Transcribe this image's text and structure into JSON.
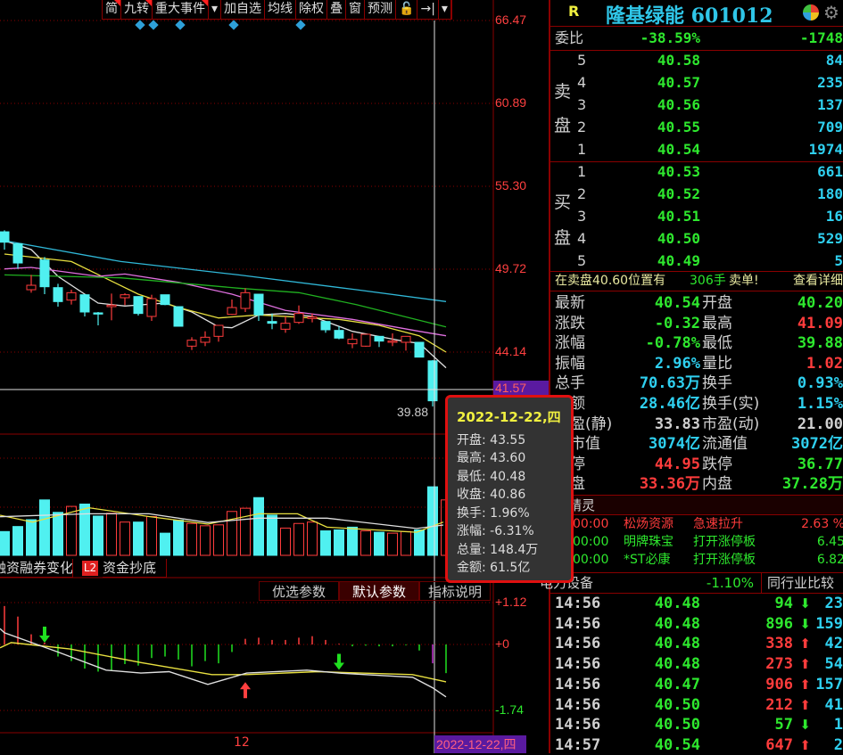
{
  "toolbar": {
    "items": [
      "简",
      "九转",
      "重大事件",
      "▾",
      "加自选",
      "均线",
      "除权",
      "叠",
      "窗",
      "预测",
      "🔓",
      "→|",
      "▾"
    ]
  },
  "colors": {
    "up": "#ff3c3c",
    "down": "#50f0f0",
    "ma5": "#e0e0e0",
    "ma10": "#e8e040",
    "ma20": "#e070e0",
    "ma30": "#20b020",
    "ma60": "#30b8d8",
    "grid": "#8a0000"
  },
  "price_axis": {
    "labels": [
      "66.47",
      "60.89",
      "55.30",
      "49.72",
      "44.14"
    ],
    "cursor_price": "41.57",
    "low_label": "39.88"
  },
  "indicator_axis": {
    "labels": [
      "+1.12",
      "+0",
      "-1.74"
    ]
  },
  "date_axis": {
    "tick": "12",
    "cursor_date": "2022-12-22,四"
  },
  "lower_tabs": {
    "tab1": "融资融券变化",
    "badge": "L2",
    "tab2": "资金抄底",
    "btn_pref": "优选参数",
    "btn_default": "默认参数",
    "btn_help": "指标说明"
  },
  "chart_data": {
    "type": "candlestick",
    "ylim": [
      39.88,
      66.47
    ],
    "candles": [
      [
        52.24,
        51.54,
        52.34,
        51.04
      ],
      [
        51.44,
        50.14,
        51.44,
        49.74
      ],
      [
        48.34,
        48.64,
        49.34,
        48.14
      ],
      [
        50.34,
        48.54,
        50.54,
        48.04
      ],
      [
        48.48,
        47.54,
        48.74,
        47.2
      ],
      [
        47.64,
        48.14,
        48.34,
        47.34
      ],
      [
        48.0,
        46.84,
        48.04,
        46.54
      ],
      [
        46.78,
        46.7,
        46.84,
        45.94
      ],
      [
        47.2,
        47.3,
        48.08,
        46.28
      ],
      [
        47.8,
        48.0,
        48.1,
        47.3
      ],
      [
        47.88,
        46.74,
        47.9,
        46.6
      ],
      [
        46.54,
        47.74,
        48.0,
        46.24
      ],
      [
        48.0,
        47.34,
        48.0,
        47.3
      ],
      [
        47.2,
        45.88,
        47.2,
        45.88
      ],
      [
        44.54,
        44.94,
        45.14,
        44.28
      ],
      [
        44.8,
        45.14,
        45.54,
        44.54
      ],
      [
        45.2,
        45.94,
        45.94,
        44.84
      ],
      [
        46.68,
        47.14,
        47.68,
        46.64
      ],
      [
        47.08,
        48.14,
        48.44,
        46.84
      ],
      [
        48.04,
        46.64,
        48.04,
        46.24
      ],
      [
        46.2,
        46.08,
        46.74,
        45.68
      ],
      [
        45.68,
        46.08,
        46.54,
        45.44
      ],
      [
        46.14,
        46.74,
        47.28,
        46.04
      ],
      [
        46.4,
        46.5,
        46.74,
        46.14
      ],
      [
        46.2,
        45.64,
        46.24,
        45.44
      ],
      [
        45.6,
        45.08,
        45.88,
        45.0
      ],
      [
        44.7,
        45.0,
        45.4,
        44.4
      ],
      [
        44.54,
        45.34,
        45.34,
        44.5
      ],
      [
        45.2,
        44.88,
        45.2,
        44.48
      ],
      [
        44.8,
        44.88,
        45.4,
        44.54
      ],
      [
        44.8,
        45.2,
        45.2,
        44.24
      ],
      [
        44.8,
        43.8,
        44.8,
        43.8
      ],
      [
        43.55,
        40.86,
        43.6,
        40.48
      ]
    ],
    "ma": [
      {
        "name": "MA5",
        "pts": [
          [
            0,
            51.64
          ],
          [
            2,
            51.04
          ],
          [
            4,
            49.24
          ],
          [
            7,
            47.44
          ],
          [
            9,
            47.24
          ],
          [
            12,
            47.44
          ],
          [
            14,
            46.84
          ],
          [
            16,
            45.84
          ],
          [
            17,
            45.78
          ],
          [
            19,
            46.64
          ],
          [
            21,
            46.74
          ],
          [
            23,
            46.54
          ],
          [
            26,
            45.54
          ],
          [
            30,
            44.84
          ],
          [
            31,
            44.74
          ],
          [
            33,
            43.08
          ]
        ]
      },
      {
        "name": "MA10",
        "pts": [
          [
            0,
            50.74
          ],
          [
            3,
            50.44
          ],
          [
            5,
            50.24
          ],
          [
            10,
            48.04
          ],
          [
            13,
            47.14
          ],
          [
            16,
            46.44
          ],
          [
            19,
            46.64
          ],
          [
            25,
            46.34
          ],
          [
            28,
            45.94
          ],
          [
            31,
            45.24
          ],
          [
            33,
            44.14
          ]
        ]
      },
      {
        "name": "MA20",
        "pts": [
          [
            0,
            49.74
          ],
          [
            2,
            49.84
          ],
          [
            7,
            49.24
          ],
          [
            9,
            49.4
          ],
          [
            13,
            48.84
          ],
          [
            17,
            48.04
          ],
          [
            21,
            46.94
          ],
          [
            26,
            46.34
          ],
          [
            31,
            45.54
          ],
          [
            33,
            45.24
          ]
        ]
      },
      {
        "name": "MA30",
        "pts": [
          [
            0,
            49.34
          ],
          [
            8.7,
            49.14
          ],
          [
            17.5,
            48.44
          ],
          [
            22,
            48.14
          ],
          [
            26.3,
            47.34
          ],
          [
            33,
            45.84
          ]
        ]
      },
      {
        "name": "MA60",
        "pts": [
          [
            0,
            51.64
          ],
          [
            8.7,
            50.24
          ],
          [
            17.5,
            49.34
          ],
          [
            26.3,
            48.34
          ],
          [
            33,
            47.54
          ]
        ]
      }
    ],
    "volume": {
      "unit": "万手",
      "values": [
        51.5,
        62.4,
        77.2,
        120,
        93,
        106,
        111,
        85,
        91,
        72,
        72,
        84,
        48,
        76,
        69,
        64,
        66,
        95,
        102,
        125,
        87,
        59,
        69,
        72,
        53,
        55,
        61,
        53,
        50,
        48,
        51.5,
        55,
        148.4,
        120
      ],
      "up": [
        0,
        0,
        0,
        0,
        0,
        1,
        0,
        0,
        1,
        1,
        0,
        1,
        0,
        0,
        1,
        1,
        1,
        1,
        1,
        0,
        0,
        1,
        1,
        1,
        0,
        0,
        0,
        1,
        0,
        1,
        1,
        0,
        0,
        1
      ],
      "ma": [
        {
          "name": "VMA5",
          "pts": [
            [
              -0.33,
              86.9
            ],
            [
              2.1,
              72
            ],
            [
              6.3,
              103
            ],
            [
              10.8,
              84
            ],
            [
              15.2,
              67.5
            ],
            [
              19,
              90
            ],
            [
              21.9,
              90
            ],
            [
              24.1,
              61
            ],
            [
              30.8,
              50
            ],
            [
              32.8,
              72
            ]
          ]
        },
        {
          "name": "VMA10",
          "pts": [
            [
              -0.33,
              83.6
            ],
            [
              6.3,
              90
            ],
            [
              10.8,
              90
            ],
            [
              15.2,
              71
            ],
            [
              19,
              80.4
            ],
            [
              24.1,
              80.4
            ],
            [
              30.8,
              58
            ],
            [
              32.8,
              65.6
            ]
          ]
        }
      ]
    },
    "indicator": {
      "ylim": [
        -1.74,
        1.12
      ],
      "hist": [
        1.02,
        0.74,
        0.27,
        0.05,
        -0.32,
        -0.44,
        -0.64,
        -0.72,
        -0.68,
        -0.52,
        -0.56,
        -0.36,
        -0.32,
        -0.4,
        -0.58,
        -0.44,
        -0.5,
        -0.2,
        0.15,
        0.18,
        0.12,
        0.12,
        0.18,
        0.22,
        0.12,
        0.02,
        -0.05,
        -0.03,
        -0.05,
        -0.05,
        -0.02,
        -0.16,
        -0.5,
        -0.76
      ],
      "dif": [
        [
          -0.33,
          0.42
        ],
        [
          0,
          0.31
        ],
        [
          4,
          -0.2
        ],
        [
          7.6,
          -0.68
        ],
        [
          10.2,
          -0.76
        ],
        [
          12.3,
          -0.72
        ],
        [
          15.2,
          -1.06
        ],
        [
          18.1,
          -0.76
        ],
        [
          22.6,
          -0.68
        ],
        [
          25,
          -0.76
        ],
        [
          30.5,
          -0.87
        ],
        [
          32,
          -1.15
        ],
        [
          33,
          -1.39
        ]
      ],
      "dea": [
        [
          -0.33,
          -0.09
        ],
        [
          0.5,
          0.05
        ],
        [
          1.8,
          0.0
        ],
        [
          4.9,
          -0.12
        ],
        [
          10.2,
          -0.48
        ],
        [
          15.5,
          -0.8
        ],
        [
          18.1,
          -0.8
        ],
        [
          23.4,
          -0.72
        ],
        [
          30.5,
          -0.8
        ],
        [
          33,
          -0.99
        ]
      ],
      "signals": [
        {
          "idx": 3,
          "type": "sell",
          "value": 0.0
        },
        {
          "idx": 25,
          "type": "sell",
          "value": -0.72
        },
        {
          "idx": 18,
          "type": "buy",
          "value": -1.0
        }
      ]
    }
  },
  "tooltip": {
    "date": "2022-12-22,四",
    "rows": [
      "开盘: 43.55",
      "最高: 43.60",
      "最低: 40.48",
      "收盘: 40.86",
      "换手: 1.96%",
      "涨幅: -6.31%",
      "总量: 148.4万",
      "金额: 61.5亿"
    ]
  },
  "quote": {
    "flag": "R",
    "name": "隆基绿能 601012",
    "weibi": {
      "label": "委比",
      "pct": "-38.59%",
      "diff": "-1748"
    },
    "sell_label": [
      "卖",
      "盘"
    ],
    "buy_label": [
      "买",
      "盘"
    ],
    "sell": [
      [
        "5",
        "40.58",
        "84"
      ],
      [
        "4",
        "40.57",
        "235"
      ],
      [
        "3",
        "40.56",
        "137"
      ],
      [
        "2",
        "40.55",
        "709"
      ],
      [
        "1",
        "40.54",
        "1974"
      ]
    ],
    "buy": [
      [
        "1",
        "40.53",
        "661"
      ],
      [
        "2",
        "40.52",
        "180"
      ],
      [
        "3",
        "40.51",
        "16"
      ],
      [
        "4",
        "40.50",
        "529"
      ],
      [
        "5",
        "40.49",
        "5"
      ]
    ],
    "notice": {
      "text": "在卖盘40.60位置有",
      "qty": "306手",
      "type": "卖单!",
      "link": "查看详细"
    },
    "stats": [
      [
        "最新",
        "40.54",
        "g",
        "开盘",
        "40.20",
        "g"
      ],
      [
        "涨跌",
        "-0.32",
        "g",
        "最高",
        "41.09",
        "rd"
      ],
      [
        "涨幅",
        "-0.78%",
        "g",
        "最低",
        "39.88",
        "g"
      ],
      [
        "振幅",
        "2.96%",
        "cy",
        "量比",
        "1.02",
        "rd"
      ],
      [
        "总手",
        "70.63万",
        "cy",
        "换手",
        "0.93%",
        "cy"
      ],
      [
        "金额",
        "28.46亿",
        "cy",
        "换手(实)",
        "1.15%",
        "cy"
      ],
      [
        "市盈(静)",
        "33.83",
        "wh",
        "市盈(动)",
        "21.00",
        "wh"
      ],
      [
        "总市值",
        "3074亿",
        "cy",
        "流通值",
        "3072亿",
        "cy"
      ],
      [
        "涨停",
        "44.95",
        "rd",
        "跌停",
        "36.77",
        "g"
      ],
      [
        "外盘",
        "33.36万",
        "rd",
        "内盘",
        "37.28万",
        "g"
      ]
    ],
    "sprite": {
      "title": "短线精灵",
      "rows": [
        [
          "00:00",
          "松炀资源",
          "急速拉升",
          "2.63 %",
          "rd"
        ],
        [
          "00:00",
          "明牌珠宝",
          "打开涨停板",
          "6.45",
          "g"
        ],
        [
          "00:00",
          "*ST必康",
          "打开涨停板",
          "6.82",
          "g"
        ]
      ]
    },
    "industry": {
      "name": "电力设备",
      "pct": "-1.10%",
      "compare": "同行业比较"
    },
    "ticks": [
      [
        "14:56",
        "40.48",
        "94",
        "down",
        "23"
      ],
      [
        "14:56",
        "40.48",
        "896",
        "down",
        "159"
      ],
      [
        "14:56",
        "40.48",
        "338",
        "up",
        "42"
      ],
      [
        "14:56",
        "40.48",
        "273",
        "up",
        "54"
      ],
      [
        "14:56",
        "40.47",
        "906",
        "up",
        "157"
      ],
      [
        "14:56",
        "40.50",
        "212",
        "up",
        "41"
      ],
      [
        "14:56",
        "40.50",
        "57",
        "down",
        "1"
      ],
      [
        "14:57",
        "40.54",
        "647",
        "up",
        "2"
      ]
    ]
  }
}
